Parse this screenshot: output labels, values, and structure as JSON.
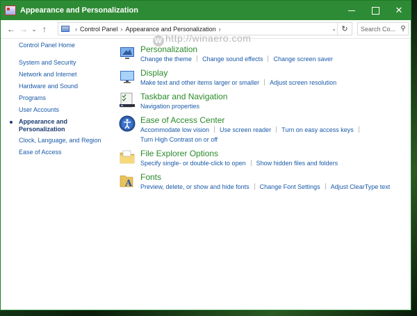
{
  "window": {
    "title": "Appearance and Personalization",
    "controls": {
      "minimize": "",
      "maximize": "",
      "close": "✕"
    }
  },
  "address": {
    "crumbs": [
      "Control Panel",
      "Appearance and Personalization"
    ],
    "refresh": "↻",
    "dropdown": "⌄"
  },
  "search": {
    "placeholder": "Search Co...",
    "icon": "⚲"
  },
  "nav": {
    "back": "←",
    "forward": "→",
    "recent": "⌄",
    "up": "↑"
  },
  "sidebar": {
    "home": "Control Panel Home",
    "items": [
      "System and Security",
      "Network and Internet",
      "Hardware and Sound",
      "Programs",
      "User Accounts",
      "Appearance and\nPersonalization",
      "Clock, Language, and Region",
      "Ease of Access"
    ],
    "current_index": 5
  },
  "categories": [
    {
      "title": "Personalization",
      "links": [
        "Change the theme",
        "Change sound effects",
        "Change screen saver"
      ],
      "links2": []
    },
    {
      "title": "Display",
      "links": [
        "Make text and other items larger or smaller",
        "Adjust screen resolution"
      ],
      "links2": []
    },
    {
      "title": "Taskbar and Navigation",
      "links": [
        "Navigation properties"
      ],
      "links2": []
    },
    {
      "title": "Ease of Access Center",
      "links": [
        "Accommodate low vision",
        "Use screen reader",
        "Turn on easy access keys"
      ],
      "links2": [
        "Turn High Contrast on or off"
      ]
    },
    {
      "title": "File Explorer Options",
      "links": [
        "Specify single- or double-click to open",
        "Show hidden files and folders"
      ],
      "links2": []
    },
    {
      "title": "Fonts",
      "links": [
        "Preview, delete, or show and hide fonts",
        "Change Font Settings",
        "Adjust ClearType text"
      ],
      "links2": []
    }
  ],
  "watermark": {
    "mark": "W",
    "text": "http://winaero.com"
  },
  "colors": {
    "titlebar": "#2e8b35",
    "link": "#1a5aa8",
    "category": "#2a8a2a"
  }
}
